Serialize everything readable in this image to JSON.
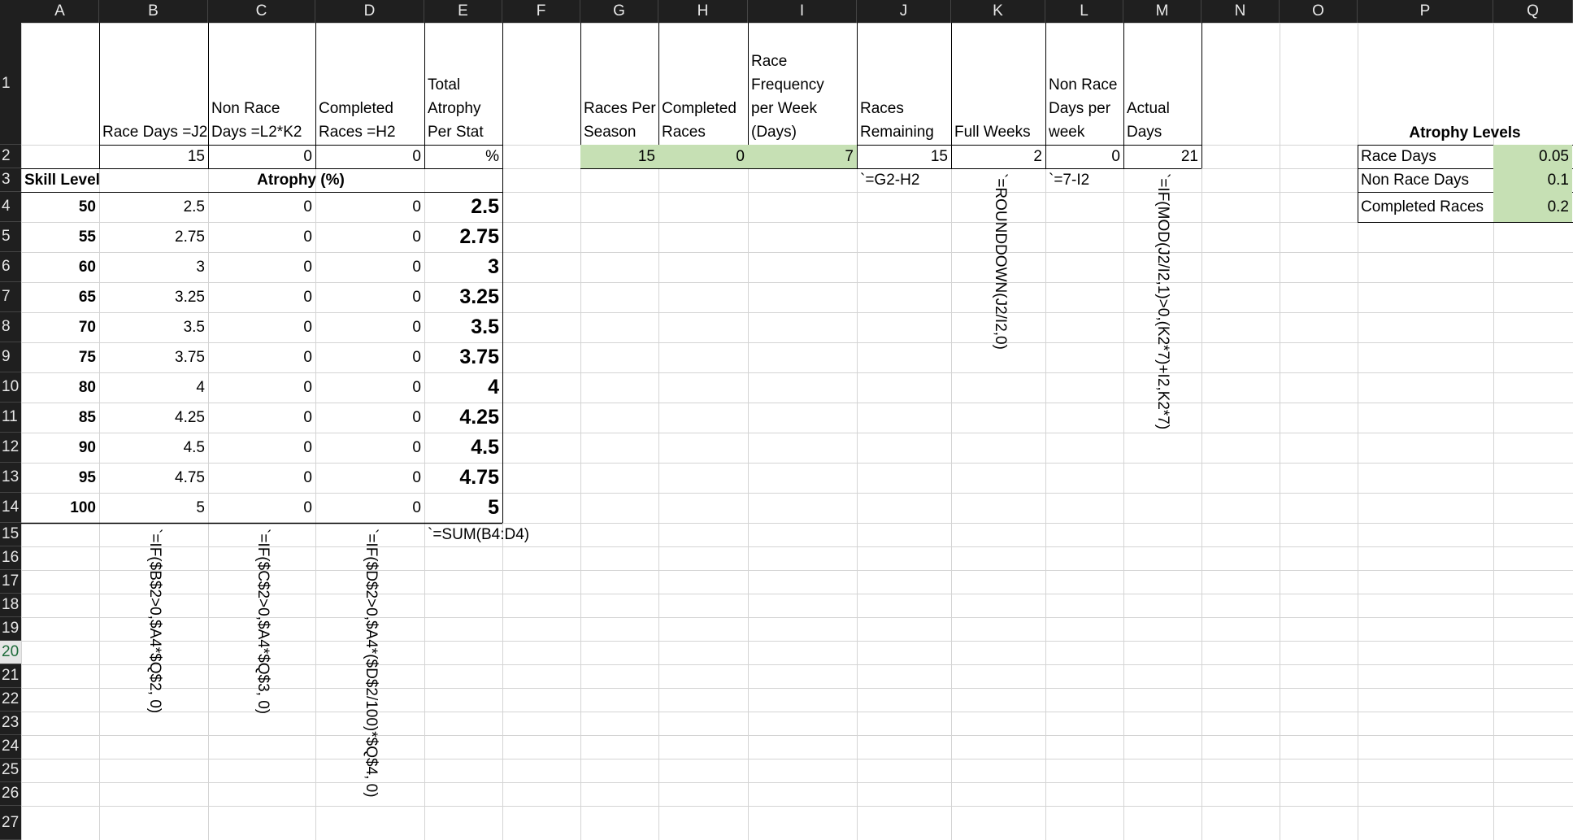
{
  "sheet": {
    "columns": [
      "A",
      "B",
      "C",
      "D",
      "E",
      "F",
      "G",
      "H",
      "I",
      "J",
      "K",
      "L",
      "M",
      "N",
      "O",
      "P",
      "Q"
    ],
    "rows": [
      "1",
      "2",
      "3",
      "4",
      "5",
      "6",
      "7",
      "8",
      "9",
      "10",
      "11",
      "12",
      "13",
      "14",
      "15",
      "16",
      "17",
      "18",
      "19",
      "20",
      "21",
      "22",
      "23",
      "24",
      "25",
      "26",
      "27"
    ],
    "selected_row": "20"
  },
  "headers": {
    "b1": "Race Days =J2",
    "c1": "Non Race\nDays =L2*K2",
    "d1": "Completed\nRaces =H2",
    "e1": "Total\nAtrophy\nPer Stat",
    "g1": "Races Per\nSeason",
    "h1": "Completed\nRaces",
    "i1": "Race\nFrequency\nper Week\n(Days)",
    "j1": "Races\nRemaining",
    "k1": "Full Weeks",
    "l1": "Non Race\nDays per\nweek",
    "m1": "Actual\nDays",
    "p1": "Atrophy Levels"
  },
  "row2": {
    "b2": "15",
    "c2": "0",
    "d2": "0",
    "e2": "%",
    "g2": "15",
    "h2": "0",
    "i2": "7",
    "j2": "15",
    "k2": "2",
    "l2": "0",
    "m2": "21"
  },
  "row3": {
    "a3": "Skill Level",
    "b3": "Atrophy (%)",
    "j3": "`=G2-H2",
    "l3": "`=7-I2"
  },
  "atrophy_levels": [
    {
      "label": "Race Days",
      "value": "0.05"
    },
    {
      "label": "Non Race Days",
      "value": "0.1"
    },
    {
      "label": "Completed Races",
      "value": "0.2"
    }
  ],
  "table": [
    {
      "skill": "50",
      "b": "2.5",
      "c": "0",
      "d": "0",
      "e": "2.5"
    },
    {
      "skill": "55",
      "b": "2.75",
      "c": "0",
      "d": "0",
      "e": "2.75"
    },
    {
      "skill": "60",
      "b": "3",
      "c": "0",
      "d": "0",
      "e": "3"
    },
    {
      "skill": "65",
      "b": "3.25",
      "c": "0",
      "d": "0",
      "e": "3.25"
    },
    {
      "skill": "70",
      "b": "3.5",
      "c": "0",
      "d": "0",
      "e": "3.5"
    },
    {
      "skill": "75",
      "b": "3.75",
      "c": "0",
      "d": "0",
      "e": "3.75"
    },
    {
      "skill": "80",
      "b": "4",
      "c": "0",
      "d": "0",
      "e": "4"
    },
    {
      "skill": "85",
      "b": "4.25",
      "c": "0",
      "d": "0",
      "e": "4.25"
    },
    {
      "skill": "90",
      "b": "4.5",
      "c": "0",
      "d": "0",
      "e": "4.5"
    },
    {
      "skill": "95",
      "b": "4.75",
      "c": "0",
      "d": "0",
      "e": "4.75"
    },
    {
      "skill": "100",
      "b": "5",
      "c": "0",
      "d": "0",
      "e": "5"
    }
  ],
  "formulas": {
    "e15": "`=SUM(B4:D4)",
    "b_vertical": "`=IF($B$2>0,$A4*$Q$2, 0)",
    "c_vertical": "`=IF($C$2>0,$A4*$Q$3, 0)",
    "d_vertical": "`=IF($D$2>0,$A4*($D$2/100)*$Q$4, 0)",
    "k_vertical": "`=ROUNDDOWN(J2/I2,0)",
    "m_vertical": "`=IF(MOD(J2/I2,1)>0,(K2*7)+I2,K2*7)"
  },
  "colors": {
    "header_bg": "#1f1f1f",
    "header_text": "#e8e8e8",
    "green_fill": "#c6e0b4",
    "gridline": "#d4d4d4"
  }
}
